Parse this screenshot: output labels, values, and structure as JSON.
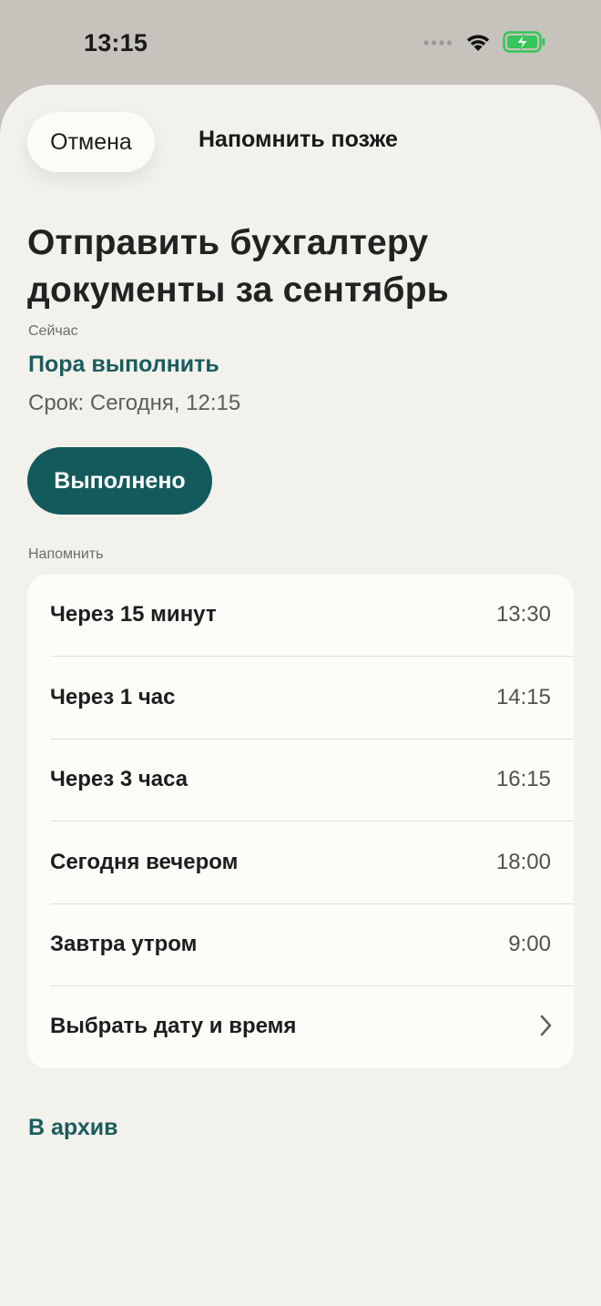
{
  "status_bar": {
    "time": "13:15",
    "battery_color": "#35c759"
  },
  "header": {
    "cancel_label": "Отмена",
    "title": "Напомнить позже"
  },
  "task": {
    "title": "Отправить бухгалтеру документы за сентябрь",
    "now_label": "Сейчас",
    "status": "Пора выполнить",
    "due": "Срок: Сегодня, 12:15"
  },
  "done_label": "Выполнено",
  "remind": {
    "section_label": "Напомнить",
    "options": [
      {
        "label": "Через 15 минут",
        "time": "13:30"
      },
      {
        "label": "Через 1 час",
        "time": "14:15"
      },
      {
        "label": "Через 3 часа",
        "time": "16:15"
      },
      {
        "label": "Сегодня вечером",
        "time": "18:00"
      },
      {
        "label": "Завтра утром",
        "time": "9:00"
      }
    ],
    "custom_label": "Выбрать дату и время"
  },
  "archive_label": "В архив",
  "colors": {
    "accent": "#145a5c",
    "link": "#1b5c5e",
    "sheet_bg": "#f3f1ec",
    "card_bg": "#fdfcf8"
  }
}
